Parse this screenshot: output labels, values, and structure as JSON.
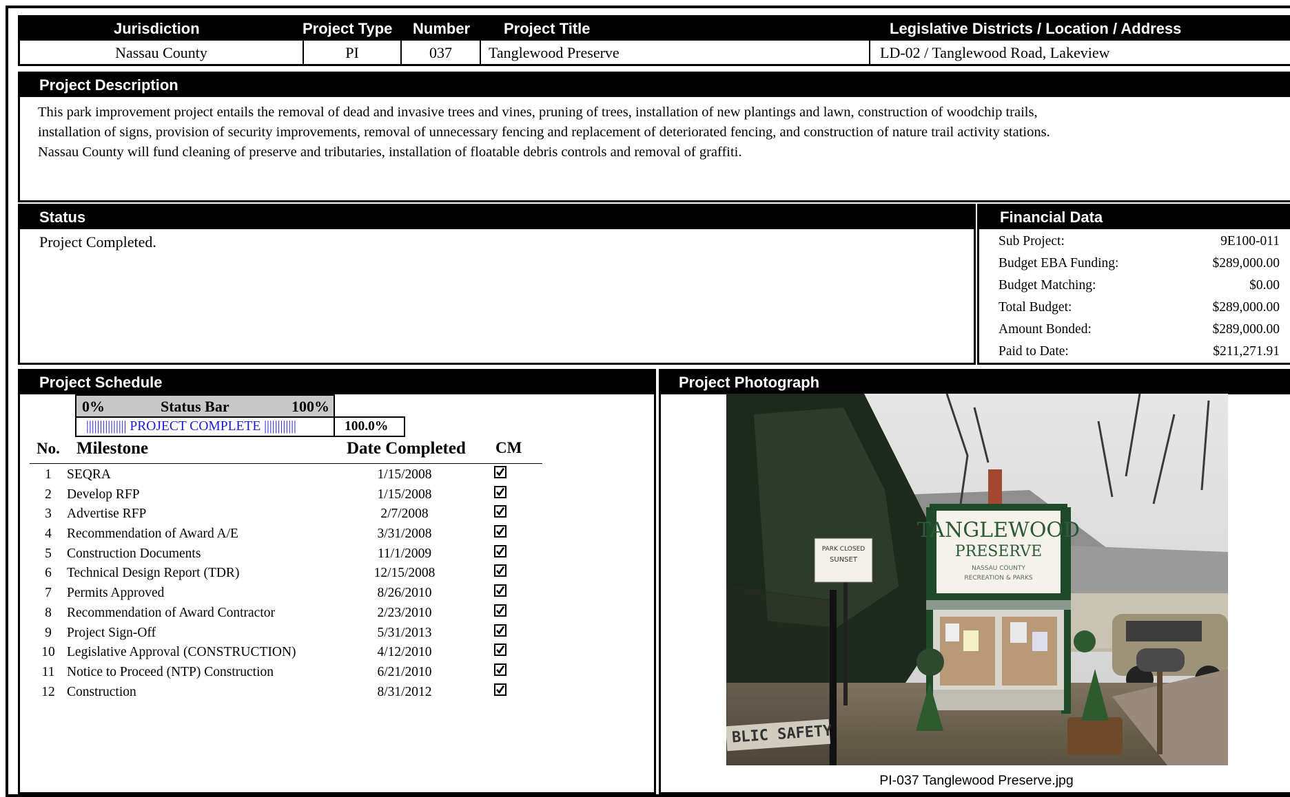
{
  "header": {
    "columns": [
      "Jurisdiction",
      "Project Type",
      "Number",
      "Project Title",
      "Legislative Districts / Location / Address"
    ],
    "values": [
      "Nassau County",
      "PI",
      "037",
      "Tanglewood Preserve",
      "LD-02 / Tanglewood Road, Lakeview"
    ]
  },
  "description": {
    "heading": "Project Description",
    "lines": [
      "This park improvement project entails the removal of dead and invasive trees and vines, pruning of trees, installation of new plantings and lawn, construction of woodchip trails,",
      "installation of signs, provision of security improvements, removal of unnecessary fencing and replacement of deteriorated fencing, and construction of nature trail activity stations.",
      "Nassau County will fund cleaning of preserve and tributaries, installation of floatable debris controls and removal of graffiti."
    ]
  },
  "status": {
    "heading": "Status",
    "text": "Project Completed."
  },
  "financial": {
    "heading": "Financial Data",
    "rows": [
      {
        "label": "Sub Project:",
        "value": "9E100-011"
      },
      {
        "label": "Budget EBA Funding:",
        "value": "$289,000.00"
      },
      {
        "label": "Budget Matching:",
        "value": "$0.00"
      },
      {
        "label": "Total Budget:",
        "value": "$289,000.00"
      },
      {
        "label": "Amount Bonded:",
        "value": "$289,000.00"
      },
      {
        "label": "Paid to Date:",
        "value": "$211,271.91"
      }
    ]
  },
  "schedule": {
    "heading": "Project Schedule",
    "status_bar": {
      "left": "0%",
      "title": "Status Bar",
      "right": "100%",
      "text": "||||||||||||||| PROJECT COMPLETE ||||||||||||",
      "percent_label": "100.0%",
      "progress": 1.0
    },
    "columns": {
      "no": "No.",
      "milestone": "Milestone",
      "date": "Date Completed",
      "cm": "CM"
    },
    "milestones": [
      {
        "no": "1",
        "name": "SEQRA",
        "date": "1/15/2008",
        "cm": true
      },
      {
        "no": "2",
        "name": "Develop RFP",
        "date": "1/15/2008",
        "cm": true
      },
      {
        "no": "3",
        "name": "Advertise RFP",
        "date": "2/7/2008",
        "cm": true
      },
      {
        "no": "4",
        "name": "Recommendation of Award A/E",
        "date": "3/31/2008",
        "cm": true
      },
      {
        "no": "5",
        "name": "Construction Documents",
        "date": "11/1/2009",
        "cm": true
      },
      {
        "no": "6",
        "name": "Technical Design Report (TDR)",
        "date": "12/15/2008",
        "cm": true
      },
      {
        "no": "7",
        "name": "Permits Approved",
        "date": "8/26/2010",
        "cm": true
      },
      {
        "no": "8",
        "name": "Recommendation of Award Contractor",
        "date": "2/23/2010",
        "cm": true
      },
      {
        "no": "9",
        "name": "Project Sign-Off",
        "date": "5/31/2013",
        "cm": true
      },
      {
        "no": "10",
        "name": "Legislative Approval (CONSTRUCTION)",
        "date": "4/12/2010",
        "cm": true
      },
      {
        "no": "11",
        "name": "Notice to Proceed (NTP) Construction",
        "date": "6/21/2010",
        "cm": true
      },
      {
        "no": "12",
        "name": "Construction",
        "date": "8/31/2012",
        "cm": true
      }
    ]
  },
  "photo": {
    "heading": "Project Photograph",
    "caption": "PI-037 Tanglewood Preserve.jpg",
    "sign_line1": "TANGLEWOOD",
    "sign_line2": "PRESERVE",
    "sign_small1": "NASSAU COUNTY",
    "sign_small2": "RECREATION & PARKS",
    "small_sign1": "PARK CLOSED",
    "small_sign2": "SUNSET",
    "fence_text": "BLIC SAFETY"
  }
}
